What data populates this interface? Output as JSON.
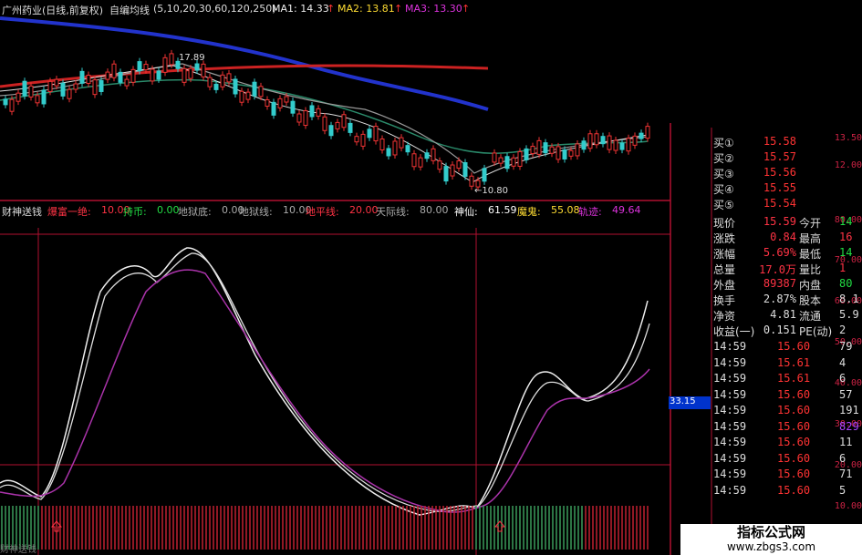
{
  "header": {
    "title": "广州药业(日线,前复权)",
    "indicator_name": "自编均线",
    "params": "(5,10,20,30,60,120,250)",
    "ma1": "MA1: 14.33",
    "ma2": "MA2: 13.81",
    "ma3": "MA3: 13.30",
    "arrow": "↑"
  },
  "price_annotations": {
    "high": "17.89",
    "low": "←10.80"
  },
  "upper_axis": [
    "13.50",
    "12.00"
  ],
  "indicator_bar": {
    "name": "财神送钱",
    "items": [
      {
        "label": "爆富一绝:",
        "value": "10.00",
        "color": "#ff3344"
      },
      {
        "label": "持币:",
        "value": "0.00",
        "color": "#22dd44"
      },
      {
        "label": "地狱底:",
        "value": "0.00",
        "color": "#aaaaaa"
      },
      {
        "label": "地狱线:",
        "value": "10.00",
        "color": "#aaaaaa"
      },
      {
        "label": "地平线:",
        "value": "20.00",
        "color": "#ff3344"
      },
      {
        "label": "天际线:",
        "value": "80.00",
        "color": "#aaaaaa"
      },
      {
        "label": "神仙:",
        "value": "61.59",
        "color": "#ffffff"
      },
      {
        "label": "魔鬼:",
        "value": "55.08",
        "color": "#ffdd33"
      },
      {
        "label": "轨迹:",
        "value": "49.64",
        "color": "#dd33dd"
      }
    ]
  },
  "lower_axis": [
    "80.00",
    "70.00",
    "60.00",
    "50.00",
    "40.00",
    "30.00",
    "20.00",
    "10.00"
  ],
  "cursor_value": "33.15",
  "bottom_label": "财神送钱",
  "quote_panel": {
    "bids": [
      {
        "label": "买①",
        "value": "15.58"
      },
      {
        "label": "买②",
        "value": "15.57"
      },
      {
        "label": "买③",
        "value": "15.56"
      },
      {
        "label": "买④",
        "value": "15.55"
      },
      {
        "label": "买⑤",
        "value": "15.54"
      }
    ],
    "stats": [
      {
        "l1": "现价",
        "v1": "15.59",
        "c1": "#ff3344",
        "l2": "今开",
        "v2": "14",
        "c2": "#22dd44"
      },
      {
        "l1": "涨跌",
        "v1": "0.84",
        "c1": "#ff3344",
        "l2": "最高",
        "v2": "16",
        "c2": "#ff3344"
      },
      {
        "l1": "涨幅",
        "v1": "5.69%",
        "c1": "#ff3344",
        "l2": "最低",
        "v2": "14",
        "c2": "#22dd44"
      },
      {
        "l1": "总量",
        "v1": "17.0万",
        "c1": "#ff3344",
        "l2": "量比",
        "v2": "1",
        "c2": "#ff3344"
      },
      {
        "l1": "外盘",
        "v1": "89387",
        "c1": "#ff3344",
        "l2": "内盘",
        "v2": "80",
        "c2": "#22dd44"
      },
      {
        "l1": "换手",
        "v1": "2.87%",
        "c1": "#dddddd",
        "l2": "股本",
        "v2": "8.1",
        "c2": "#dddddd"
      },
      {
        "l1": "净资",
        "v1": "4.81",
        "c1": "#dddddd",
        "l2": "流通",
        "v2": "5.9",
        "c2": "#dddddd"
      },
      {
        "l1": "收益(一)",
        "v1": "0.151",
        "c1": "#dddddd",
        "l2": "PE(动)",
        "v2": "2",
        "c2": "#dddddd"
      }
    ],
    "ticks": [
      {
        "time": "14:59",
        "price": "15.60",
        "vol": "79",
        "vc": "#dddddd"
      },
      {
        "time": "14:59",
        "price": "15.61",
        "vol": "4",
        "vc": "#dddddd"
      },
      {
        "time": "14:59",
        "price": "15.61",
        "vol": "6",
        "vc": "#dddddd"
      },
      {
        "time": "14:59",
        "price": "15.60",
        "vol": "57",
        "vc": "#dddddd"
      },
      {
        "time": "14:59",
        "price": "15.60",
        "vol": "191",
        "vc": "#dddddd"
      },
      {
        "time": "14:59",
        "price": "15.60",
        "vol": "829",
        "vc": "#aa44ff"
      },
      {
        "time": "14:59",
        "price": "15.60",
        "vol": "11",
        "vc": "#dddddd"
      },
      {
        "time": "14:59",
        "price": "15.60",
        "vol": "6",
        "vc": "#dddddd"
      },
      {
        "time": "14:59",
        "price": "15.60",
        "vol": "71",
        "vc": "#dddddd"
      },
      {
        "time": "14:59",
        "price": "15.60",
        "vol": "5",
        "vc": "#dddddd"
      }
    ]
  },
  "watermark": {
    "title": "指标公式网",
    "url": "www.zbgs3.com"
  },
  "colors": {
    "background": "#000000",
    "grid_red": "#b01030",
    "ma_blue": "#2233cc",
    "ma_red": "#cc2222"
  }
}
